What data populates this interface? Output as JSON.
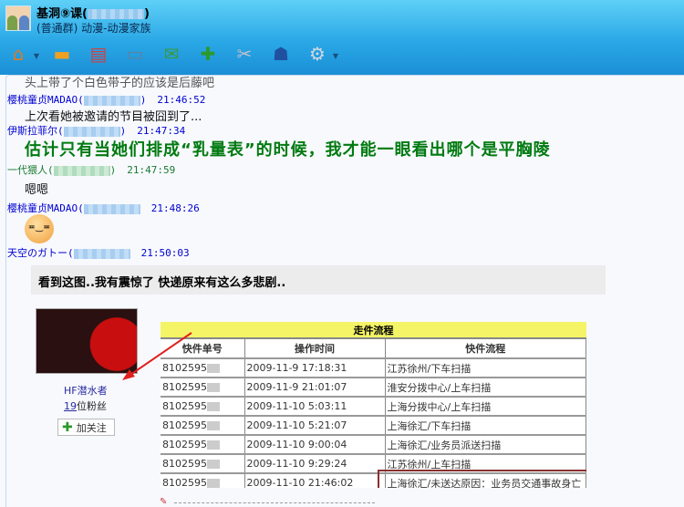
{
  "window": {
    "title": "基洞⑨课",
    "subtitle": "(普通群) 动漫-动漫家族"
  },
  "toolbar": [
    {
      "icon": "home-icon"
    },
    {
      "icon": "folder-share-icon"
    },
    {
      "icon": "album-icon"
    },
    {
      "icon": "card-icon"
    },
    {
      "icon": "mail-forward-icon"
    },
    {
      "icon": "new-message-icon"
    },
    {
      "icon": "tools-icon"
    },
    {
      "icon": "police-icon"
    },
    {
      "icon": "settings-icon"
    }
  ],
  "messages": [
    {
      "text": "头上带了个白色带子的应该是后藤吧"
    },
    {
      "name": "樱桃童贞MADAO(",
      "time": "21:46:52",
      "text": "上次看她被邀请的节目被囧到了..."
    },
    {
      "name": "伊斯拉菲尔(",
      "time": "21:47:34",
      "text": "估计只有当她们排成“乳量表”的时候，我才能一眼看出哪个是平胸陵"
    },
    {
      "name": "一代猥人(",
      "time": "21:47:59",
      "text": "嗯嗯"
    },
    {
      "name": "樱桃童贞MADAO(",
      "time": "21:48:26"
    },
    {
      "name": "天空のガトー(",
      "time": "21:50:03"
    }
  ],
  "post": {
    "title": "看到这图..我有震惊了 快递原来有这么多悲剧..",
    "user": "HF潜水者",
    "fans_count": "19",
    "fans_label": "位粉丝",
    "follow": "加关注"
  },
  "table": {
    "caption": "走件流程",
    "headers": [
      "快件单号",
      "操作时间",
      "快件流程"
    ],
    "rows": [
      [
        "8102595",
        "2009-11-9 17:18:31",
        "江苏徐州/下车扫描"
      ],
      [
        "8102595",
        "2009-11-9 21:01:07",
        "淮安分拨中心/上车扫描"
      ],
      [
        "8102595",
        "2009-11-10 5:03:11",
        "上海分拨中心/上车扫描"
      ],
      [
        "8102595",
        "2009-11-10 5:21:07",
        "上海徐汇/下车扫描"
      ],
      [
        "8102595",
        "2009-11-10 9:00:04",
        "上海徐汇/业务员派送扫描"
      ],
      [
        "8102595",
        "2009-11-10 9:29:24",
        "江苏徐州/上车扫描"
      ],
      [
        "8102595",
        "2009-11-10 21:46:02",
        "上海徐汇/未送达原因：业务员交通事故身亡"
      ]
    ]
  }
}
